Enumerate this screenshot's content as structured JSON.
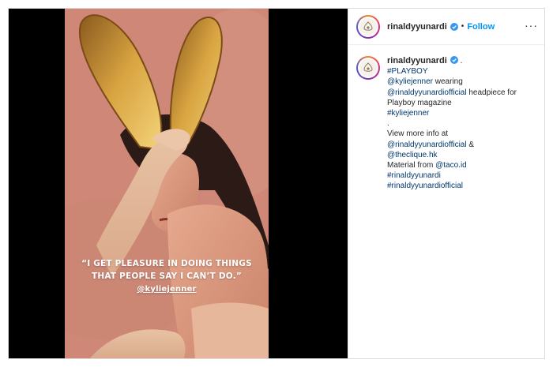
{
  "post": {
    "quote": {
      "line1": "“I GET PLEASURE IN DOING THINGS",
      "line2": "THAT PEOPLE SAY I CAN’T DO.”",
      "handle": "@kyliejenner"
    }
  },
  "header": {
    "username": "rinaldyyunardi",
    "dot": "•",
    "follow_label": "Follow",
    "more_label": "···"
  },
  "caption": {
    "username": "rinaldyyunardi",
    "after_name": " .",
    "lines": [
      [
        {
          "t": "#PLAYBOY",
          "link": true
        }
      ],
      [
        {
          "t": "@kyliejenner",
          "link": true
        },
        {
          "t": " wearing",
          "link": false
        }
      ],
      [
        {
          "t": "@rinaldyyunardiofficial",
          "link": true
        },
        {
          "t": " headpiece for",
          "link": false
        }
      ],
      [
        {
          "t": "Playboy magazine",
          "link": false
        }
      ],
      [
        {
          "t": "#kyliejenner",
          "link": true
        }
      ],
      [
        {
          "t": ".",
          "link": false
        }
      ],
      [
        {
          "t": "View more info at",
          "link": false
        }
      ],
      [
        {
          "t": "@rinaldyyunardiofficial",
          "link": true
        },
        {
          "t": " &",
          "link": false
        }
      ],
      [
        {
          "t": "@theclique.hk",
          "link": true
        }
      ],
      [
        {
          "t": "Material from ",
          "link": false
        },
        {
          "t": "@taco.id",
          "link": true
        }
      ],
      [
        {
          "t": "#rinaldyyunardi",
          "link": true
        }
      ],
      [
        {
          "t": "#rinaldyyunardiofficial",
          "link": true
        }
      ]
    ]
  },
  "colors": {
    "link": "#00376b",
    "follow": "#0095f6",
    "verified": "#3897f0",
    "photo_bg": "#d08979"
  },
  "icons": {
    "avatar": "avatar-logo-icon",
    "verified": "verified-badge-icon",
    "more": "more-options-icon"
  }
}
